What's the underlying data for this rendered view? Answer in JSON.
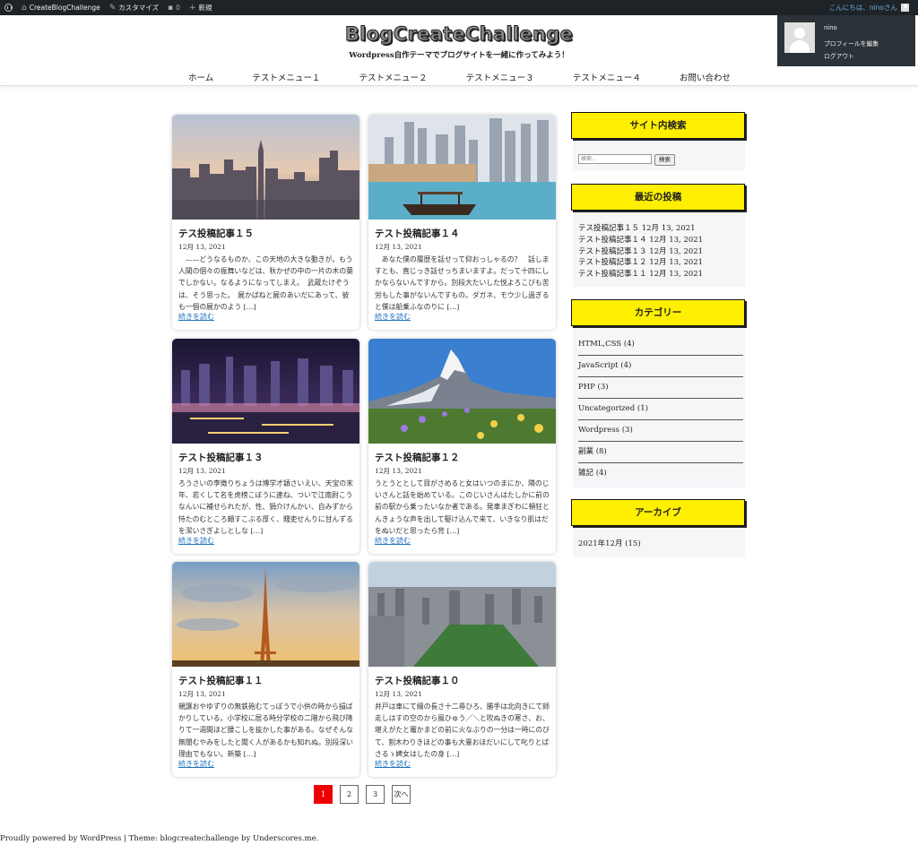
{
  "admin_bar": {
    "site_name": "CreateBlogChallenge",
    "customize": "カスタマイズ",
    "comments_count": "0",
    "new_label": "新規",
    "greeting": "こんにちは、",
    "user": "nino",
    "san": " さん"
  },
  "account_menu": {
    "username": "nino",
    "edit_profile": "プロフィールを編集",
    "logout": "ログアウト"
  },
  "site": {
    "title": "BlogCreateChallenge",
    "tagline": "Wordpress自作テーマでブログサイトを一緒に作ってみよう！"
  },
  "nav": [
    "ホーム",
    "テストメニュー１",
    "テストメニュー２",
    "テストメニュー３",
    "テストメニュー４",
    "お問い合わせ"
  ],
  "posts": [
    {
      "title": "テス投稿記事１５",
      "date": "12月 13, 2021",
      "excerpt": "　——どうなるものか、この天地の大きな動きが。もう人間の個々の振舞いなどは、秋かぜの中の一片の木の葉でしかない。なるようになってしまえ。　武蔵たけぞうは、そう思った。　屍かばねと屍のあいだにあって、彼も一個の屍かのよう […]",
      "more": "続きを読む",
      "thumb": "city-sunset"
    },
    {
      "title": "テスト投稿記事１４",
      "date": "12月 13, 2021",
      "excerpt": "　あなた僕の履歴を話せって仰おっしゃるの？　話しますとも、直じっき話せっちまいますよ。だって十四にしかならないんですから。別段大たいした悦よろこびも苦労もした事がないんですもの。ダガネ、モウ少し過ぎると僕は船乗ふなのりに […]",
      "more": "続きを読む",
      "thumb": "dubai-boat"
    },
    {
      "title": "テスト投稿記事１３",
      "date": "12月 13, 2021",
      "excerpt": "ろうさいの李徴りちょうは博学才穎さいえい、天宝の末年、若くして名を虎榜こぼうに連ね、ついで江南尉こうなんいに補せられたが、性、狷介けんかい、自みずから恃たのむところ頗すこぶる厚く、賤吏せんりに甘んずるを潔いさぎよしとしな […]",
      "more": "続きを読む",
      "thumb": "night-city"
    },
    {
      "title": "テスト投稿記事１２",
      "date": "12月 13, 2021",
      "excerpt": "うとうととして目がさめると女はいつのまにか、隣のじいさんと話を始めている。このじいさんはたしかに前の前の駅から乗ったいなか者である。発車まぎわに頓狂とんきょうな声を出して駆け込んで来て、いきなり肌はだをぬいだと思ったら背 […]",
      "more": "続きを読む",
      "thumb": "mountain"
    },
    {
      "title": "テスト投稿記事１１",
      "date": "12月 13, 2021",
      "excerpt": "親譲おやゆずりの無鉄砲むてっぽうで小供の時から損ばかりしている。小学校に居る時分学校の二階から飛び降りて一週間ほど腰こしを抜かした事がある。なぜそんな無闇むやみをしたと聞く人があるかも知れぬ。別段深い理由でもない。新築 […]",
      "more": "続きを読む",
      "thumb": "eiffel"
    },
    {
      "title": "テスト投稿記事１０",
      "date": "12月 13, 2021",
      "excerpt": "井戸は車にて綱の長さ十二尋ひろ、勝手は北向きにて師走しはすの空のから風ひゅう／＼と吹ぬきの寒さ、お、堪えがたと竈かまどの前に火なぶりの一分は一時にのびて、割木わりきほどの事も大臺おほだいにして叱りとばさるゝ婢女はしたの身 […]",
      "more": "続きを読む",
      "thumb": "nyc"
    }
  ],
  "sidebar": {
    "search": {
      "title": "サイト内検索",
      "placeholder": "検索…",
      "button": "検索"
    },
    "recent": {
      "title": "最近の投稿",
      "items": [
        {
          "title": "テス投稿記事１５",
          "date": "12月 13, 2021"
        },
        {
          "title": "テスト投稿記事１４",
          "date": "12月 13, 2021"
        },
        {
          "title": "テスト投稿記事１３",
          "date": "12月 13, 2021"
        },
        {
          "title": "テスト投稿記事１２",
          "date": "12月 13, 2021"
        },
        {
          "title": "テスト投稿記事１１",
          "date": "12月 13, 2021"
        }
      ]
    },
    "categories": {
      "title": "カテゴリー",
      "items": [
        "HTML,CSS (4)",
        "JavaScript (4)",
        "PHP (3)",
        "Uncategorized (1)",
        "Wordpress (3)",
        "副業 (8)",
        "雑記 (4)"
      ]
    },
    "archive": {
      "title": "アーカイブ",
      "items": [
        "2021年12月 (15)"
      ]
    }
  },
  "pagination": {
    "pages": [
      "1",
      "2",
      "3"
    ],
    "current": "1",
    "next": "次へ"
  },
  "footer": {
    "text": "Proudly powered by WordPress | Theme: blogcreatechallenge by Underscores.me."
  }
}
